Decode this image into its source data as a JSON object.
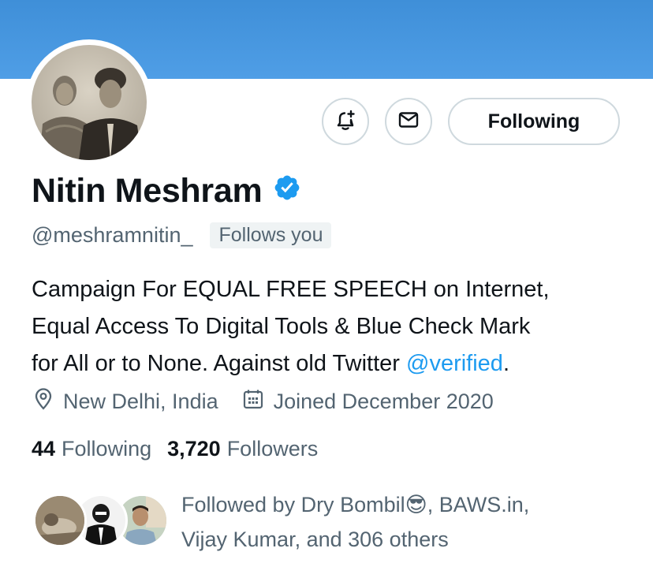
{
  "profile": {
    "name": "Nitin Meshram",
    "handle": "@meshramnitin_",
    "follows_you": "Follows you",
    "bio_line1": "Campaign For EQUAL FREE SPEECH on Internet,",
    "bio_line2": "Equal Access To Digital Tools & Blue Check Mark",
    "bio_line3_pre": "for All or to None. Against old Twitter ",
    "bio_link": "@verified",
    "bio_line3_post": ".",
    "location": "New Delhi, India",
    "joined": "Joined December 2020"
  },
  "actions": {
    "notify_icon": "bell-plus-icon",
    "message_icon": "envelope-icon",
    "follow_label": "Following"
  },
  "stats": {
    "following_count": "44",
    "following_label": "Following",
    "followers_count": "3,720",
    "followers_label": "Followers"
  },
  "followed_by": {
    "line1": "Followed by Dry Bombil😎, BAWS.in,",
    "line2": "Vijay Kumar, and 306 others"
  },
  "colors": {
    "banner": "#4a9be3",
    "verified": "#1d9bf0",
    "link": "#1d9bf0",
    "secondary_text": "#536471"
  }
}
